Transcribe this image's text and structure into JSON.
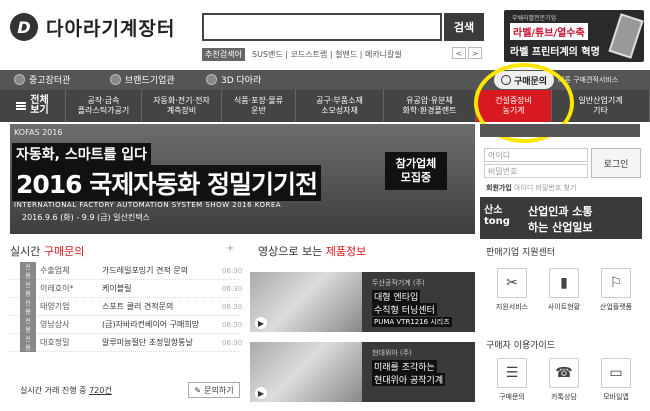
{
  "header": {
    "logo_mark": "D",
    "logo_text": "다아라기계장터",
    "search_button": "검색",
    "rec_tag": "추천검색어",
    "rec_links": "SUS밴드 | 코드스트랩 | 철밴드 | 메카니칼씰",
    "nav_prev": "<",
    "nav_next": ">"
  },
  "ad_top": {
    "small": "부쉐라벨전문기업",
    "line1": "라벨/튜브/열수축",
    "line2": "라벨 프린터계의 혁명"
  },
  "topnav": [
    "중고장터관",
    "브랜드기업관",
    "3D 다아라"
  ],
  "inquiry": {
    "button": "구매문의",
    "sub": "빠른 구매견적서비스"
  },
  "categories": [
    {
      "label": "전체\n보기"
    },
    {
      "label": "공작·금속\n플라스틱가공기"
    },
    {
      "label": "자동화·전기·전자\n계측장비"
    },
    {
      "label": "식품·포장·물류\n운반"
    },
    {
      "label": "공구·부품소재\n소모성자재"
    },
    {
      "label": "유공압·유분체\n화학·환경플랜트"
    },
    {
      "label": "건설중장비\n농기계"
    },
    {
      "label": "일반산업기계\n기타"
    }
  ],
  "banner": {
    "kofas": "KOFAS 2016",
    "sub": "자동화, 스마트를 입다",
    "title": "2016 국제자동화 정밀기기전",
    "en": "INTERNATIONAL FACTORY AUTOMATION SYSTEM SHOW 2016 KOREA",
    "date": "2016.9.6 (화) - 9.9 (금) 일산킨텍스",
    "badge": "참가업체\n모집중"
  },
  "login": {
    "placeholder": "",
    "id_placeholder": "아이디",
    "pw_placeholder": "비밀번호",
    "button": "로그인",
    "join": "회원가입",
    "find": "아이디 비밀번호 찾기"
  },
  "industry_ad": {
    "logo": "산소\ntong",
    "l1": "산업인과 소통",
    "l2": "하는 산업일보"
  },
  "live_inquiries": {
    "title_main": "실시간",
    "title_red": "구매문의",
    "more": "+",
    "items": [
      {
        "tag": "신용",
        "company": "수출업체",
        "title": "가드레일포밍기 견적 문의",
        "time": "06:30"
      },
      {
        "tag": "신용",
        "company": "이레호이*",
        "title": "케이블릴",
        "time": "06:30"
      },
      {
        "tag": "신용",
        "company": "태양기업",
        "title": "스포트 쿨러 견적문의",
        "time": "06:30"
      },
      {
        "tag": "신용",
        "company": "영남상사",
        "title": "(금)자바라컨베이어 구매희망",
        "time": "06:30"
      },
      {
        "tag": "신용",
        "company": "대호정밀",
        "title": "알루미늄절단 초정밀항통날",
        "time": "06:30"
      }
    ],
    "total_label": "실시간 거래 진행 중",
    "total": "720건",
    "write": "문의하기"
  },
  "video": {
    "title_main": "영상으로 보는",
    "title_red": "제품정보",
    "items": [
      {
        "company": "두산공작기계 (주)",
        "d1": "대형 엔타입",
        "d2": "수직형 터닝센터",
        "d3": "PUMA VTR1216 시리즈"
      },
      {
        "company": "현대위아 (주)",
        "d1": "미래를 조각하는",
        "d2": "현대위아 공작기계",
        "d3": ""
      }
    ]
  },
  "support": {
    "title": "판매기업 지원센터",
    "items": [
      {
        "icon": "✂",
        "label": "지원서비스"
      },
      {
        "icon": "▮",
        "label": "사이트현황"
      },
      {
        "icon": "⚐",
        "label": "산업플랫폼"
      }
    ]
  },
  "customer": {
    "title": "구매자 이용가이드",
    "items": [
      {
        "icon": "☰",
        "label": "구매문의"
      },
      {
        "icon": "☎",
        "label": "카톡상담"
      },
      {
        "icon": "▭",
        "label": "모바일앱"
      }
    ]
  }
}
